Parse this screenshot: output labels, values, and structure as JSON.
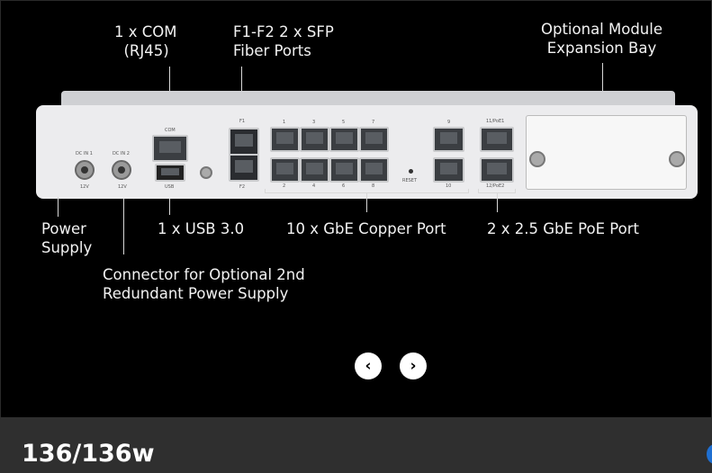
{
  "labels": {
    "com": "1 x COM\n  (RJ45)",
    "sfp": "F1-F2 2 x SFP\nFiber Ports",
    "module": "Optional Module\nExpansion Bay",
    "power": "Power\nSupply",
    "usb": "1 x USB 3.0",
    "copper": "10 x GbE Copper Port",
    "poe": "2 x 2.5 GbE PoE Port",
    "redundant": "Connector for Optional 2nd\nRedundant Power Supply"
  },
  "device": {
    "dc1": "DC IN 1",
    "dc2": "DC IN 2",
    "v1": "12V",
    "v2": "12V",
    "com": "COM",
    "usb": "USB",
    "f1": "F1",
    "f2": "F2",
    "reset": "RESET",
    "top_nums": [
      "1",
      "3",
      "5",
      "7"
    ],
    "bottom_nums": [
      "2",
      "4",
      "6",
      "8"
    ],
    "n9": "9",
    "n10": "10",
    "poe1": "11/PoE1",
    "poe2": "12/PoE2"
  },
  "carousel": {
    "prev": "‹",
    "next": "›"
  },
  "product_title": "136/136w"
}
